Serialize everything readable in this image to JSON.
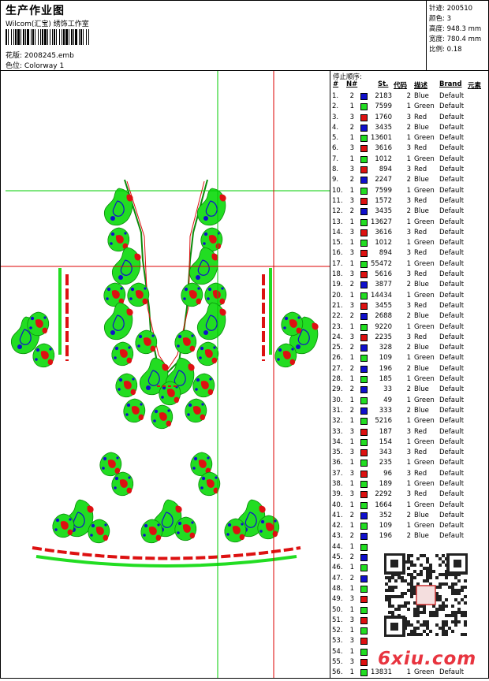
{
  "header": {
    "title": "生产作业图",
    "subtitle": "Wilcom(汇宝) 绣饰工作室",
    "design_label": "花版:",
    "design_value": "2008245.emb",
    "colorway_label": "色位:",
    "colorway_value": "Colorway 1"
  },
  "specs": [
    {
      "label": "针迹:",
      "value": "200510"
    },
    {
      "label": "颜色:",
      "value": "3"
    },
    {
      "label": "高度:",
      "value": "948.3 mm"
    },
    {
      "label": "宽度:",
      "value": "780.4 mm"
    },
    {
      "label": "比例:",
      "value": "0.18"
    }
  ],
  "legend": {
    "title": "停止顺序:",
    "headers": {
      "no": "#",
      "n": "N#",
      "st": "St.",
      "code": "代码",
      "desc": "描述",
      "brand": "Brand",
      "elem": "元素"
    },
    "rows": [
      {
        "no": "1.",
        "n": "2",
        "st": "2183",
        "code": "2",
        "desc": "Blue",
        "brand": "Default"
      },
      {
        "no": "2.",
        "n": "1",
        "st": "7599",
        "code": "1",
        "desc": "Green",
        "brand": "Default"
      },
      {
        "no": "3.",
        "n": "3",
        "st": "1760",
        "code": "3",
        "desc": "Red",
        "brand": "Default"
      },
      {
        "no": "4.",
        "n": "2",
        "st": "3435",
        "code": "2",
        "desc": "Blue",
        "brand": "Default"
      },
      {
        "no": "5.",
        "n": "1",
        "st": "13601",
        "code": "1",
        "desc": "Green",
        "brand": "Default"
      },
      {
        "no": "6.",
        "n": "3",
        "st": "3616",
        "code": "3",
        "desc": "Red",
        "brand": "Default"
      },
      {
        "no": "7.",
        "n": "1",
        "st": "1012",
        "code": "1",
        "desc": "Green",
        "brand": "Default"
      },
      {
        "no": "8.",
        "n": "3",
        "st": "894",
        "code": "3",
        "desc": "Red",
        "brand": "Default"
      },
      {
        "no": "9.",
        "n": "2",
        "st": "2247",
        "code": "2",
        "desc": "Blue",
        "brand": "Default"
      },
      {
        "no": "10.",
        "n": "1",
        "st": "7599",
        "code": "1",
        "desc": "Green",
        "brand": "Default"
      },
      {
        "no": "11.",
        "n": "3",
        "st": "1572",
        "code": "3",
        "desc": "Red",
        "brand": "Default"
      },
      {
        "no": "12.",
        "n": "2",
        "st": "3435",
        "code": "2",
        "desc": "Blue",
        "brand": "Default"
      },
      {
        "no": "13.",
        "n": "1",
        "st": "13627",
        "code": "1",
        "desc": "Green",
        "brand": "Default"
      },
      {
        "no": "14.",
        "n": "3",
        "st": "3616",
        "code": "3",
        "desc": "Red",
        "brand": "Default"
      },
      {
        "no": "15.",
        "n": "1",
        "st": "1012",
        "code": "1",
        "desc": "Green",
        "brand": "Default"
      },
      {
        "no": "16.",
        "n": "3",
        "st": "894",
        "code": "3",
        "desc": "Red",
        "brand": "Default"
      },
      {
        "no": "17.",
        "n": "1",
        "st": "55472",
        "code": "1",
        "desc": "Green",
        "brand": "Default"
      },
      {
        "no": "18.",
        "n": "3",
        "st": "5616",
        "code": "3",
        "desc": "Red",
        "brand": "Default"
      },
      {
        "no": "19.",
        "n": "2",
        "st": "3877",
        "code": "2",
        "desc": "Blue",
        "brand": "Default"
      },
      {
        "no": "20.",
        "n": "1",
        "st": "14434",
        "code": "1",
        "desc": "Green",
        "brand": "Default"
      },
      {
        "no": "21.",
        "n": "3",
        "st": "3455",
        "code": "3",
        "desc": "Red",
        "brand": "Default"
      },
      {
        "no": "22.",
        "n": "2",
        "st": "2688",
        "code": "2",
        "desc": "Blue",
        "brand": "Default"
      },
      {
        "no": "23.",
        "n": "1",
        "st": "9220",
        "code": "1",
        "desc": "Green",
        "brand": "Default"
      },
      {
        "no": "24.",
        "n": "3",
        "st": "2235",
        "code": "3",
        "desc": "Red",
        "brand": "Default"
      },
      {
        "no": "25.",
        "n": "2",
        "st": "328",
        "code": "2",
        "desc": "Blue",
        "brand": "Default"
      },
      {
        "no": "26.",
        "n": "1",
        "st": "109",
        "code": "1",
        "desc": "Green",
        "brand": "Default"
      },
      {
        "no": "27.",
        "n": "2",
        "st": "196",
        "code": "2",
        "desc": "Blue",
        "brand": "Default"
      },
      {
        "no": "28.",
        "n": "1",
        "st": "185",
        "code": "1",
        "desc": "Green",
        "brand": "Default"
      },
      {
        "no": "29.",
        "n": "2",
        "st": "33",
        "code": "2",
        "desc": "Blue",
        "brand": "Default"
      },
      {
        "no": "30.",
        "n": "1",
        "st": "49",
        "code": "1",
        "desc": "Green",
        "brand": "Default"
      },
      {
        "no": "31.",
        "n": "2",
        "st": "333",
        "code": "2",
        "desc": "Blue",
        "brand": "Default"
      },
      {
        "no": "32.",
        "n": "1",
        "st": "5216",
        "code": "1",
        "desc": "Green",
        "brand": "Default"
      },
      {
        "no": "33.",
        "n": "3",
        "st": "187",
        "code": "3",
        "desc": "Red",
        "brand": "Default"
      },
      {
        "no": "34.",
        "n": "1",
        "st": "154",
        "code": "1",
        "desc": "Green",
        "brand": "Default"
      },
      {
        "no": "35.",
        "n": "3",
        "st": "343",
        "code": "3",
        "desc": "Red",
        "brand": "Default"
      },
      {
        "no": "36.",
        "n": "1",
        "st": "235",
        "code": "1",
        "desc": "Green",
        "brand": "Default"
      },
      {
        "no": "37.",
        "n": "3",
        "st": "96",
        "code": "3",
        "desc": "Red",
        "brand": "Default"
      },
      {
        "no": "38.",
        "n": "1",
        "st": "189",
        "code": "1",
        "desc": "Green",
        "brand": "Default"
      },
      {
        "no": "39.",
        "n": "3",
        "st": "2292",
        "code": "3",
        "desc": "Red",
        "brand": "Default"
      },
      {
        "no": "40.",
        "n": "1",
        "st": "1664",
        "code": "1",
        "desc": "Green",
        "brand": "Default"
      },
      {
        "no": "41.",
        "n": "2",
        "st": "352",
        "code": "2",
        "desc": "Blue",
        "brand": "Default"
      },
      {
        "no": "42.",
        "n": "1",
        "st": "109",
        "code": "1",
        "desc": "Green",
        "brand": "Default"
      },
      {
        "no": "43.",
        "n": "2",
        "st": "196",
        "code": "2",
        "desc": "Blue",
        "brand": "Default"
      },
      {
        "no": "44.",
        "n": "1",
        "st": "",
        "code": "",
        "desc": "",
        "brand": ""
      },
      {
        "no": "45.",
        "n": "2",
        "st": "",
        "code": "",
        "desc": "",
        "brand": ""
      },
      {
        "no": "46.",
        "n": "1",
        "st": "",
        "code": "",
        "desc": "",
        "brand": ""
      },
      {
        "no": "47.",
        "n": "2",
        "st": "",
        "code": "",
        "desc": "",
        "brand": ""
      },
      {
        "no": "48.",
        "n": "1",
        "st": "",
        "code": "",
        "desc": "",
        "brand": ""
      },
      {
        "no": "49.",
        "n": "3",
        "st": "",
        "code": "",
        "desc": "",
        "brand": ""
      },
      {
        "no": "50.",
        "n": "1",
        "st": "",
        "code": "",
        "desc": "",
        "brand": ""
      },
      {
        "no": "51.",
        "n": "3",
        "st": "",
        "code": "",
        "desc": "",
        "brand": ""
      },
      {
        "no": "52.",
        "n": "1",
        "st": "",
        "code": "",
        "desc": "",
        "brand": ""
      },
      {
        "no": "53.",
        "n": "3",
        "st": "",
        "code": "",
        "desc": "",
        "brand": ""
      },
      {
        "no": "54.",
        "n": "1",
        "st": "",
        "code": "",
        "desc": "",
        "brand": ""
      },
      {
        "no": "55.",
        "n": "3",
        "st": "",
        "code": "",
        "desc": "",
        "brand": ""
      },
      {
        "no": "56.",
        "n": "1",
        "st": "13831",
        "code": "1",
        "desc": "Green",
        "brand": "Default"
      }
    ]
  },
  "watermark": "6xiu.com",
  "colors": {
    "1": "#22dd22",
    "2": "#1010cc",
    "3": "#dd1111",
    "guide_green": "#00cc00",
    "guide_red": "#dd0000"
  }
}
